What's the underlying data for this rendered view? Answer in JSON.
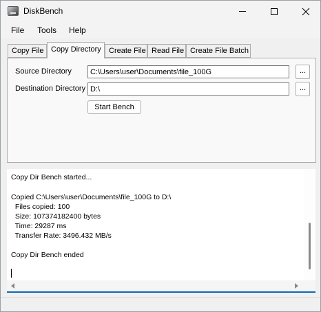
{
  "window": {
    "title": "DiskBench",
    "icon": "app-drive-icon"
  },
  "menu": [
    "File",
    "Tools",
    "Help"
  ],
  "tabs": [
    {
      "label": "Copy File",
      "active": false
    },
    {
      "label": "Copy Directory",
      "active": true
    },
    {
      "label": "Create File",
      "active": false
    },
    {
      "label": "Read File",
      "active": false
    },
    {
      "label": "Create File Batch",
      "active": false
    }
  ],
  "form": {
    "source_label": "Source Directory",
    "source_value": "C:\\Users\\user\\Documents\\file_100G",
    "destination_label": "Destination Directory",
    "destination_value": "D:\\",
    "browse_label": "...",
    "start_label": "Start Bench"
  },
  "log": [
    "Copy Dir Bench started...",
    "",
    "Copied C:\\Users\\user\\Documents\\file_100G to D:\\",
    "  Files copied: 100",
    "  Size: 107374182400 bytes",
    "  Time: 29287 ms",
    "  Transfer Rate: 3496.432 MB/s",
    "",
    "Copy Dir Bench ended"
  ],
  "colors": {
    "accent": "#0d6ab4",
    "window_bg": "#f0f0f0",
    "panel_bg": "#f9f9f9"
  }
}
